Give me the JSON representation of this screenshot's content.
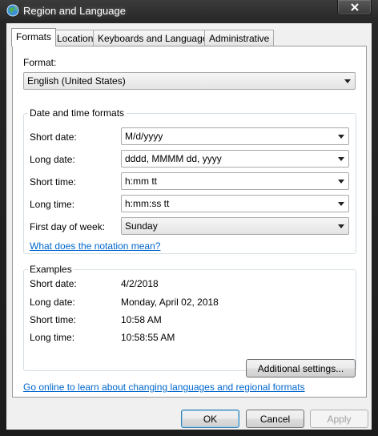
{
  "window": {
    "title": "Region and Language"
  },
  "tabs": [
    {
      "label": "Formats"
    },
    {
      "label": "Location"
    },
    {
      "label": "Keyboards and Languages"
    },
    {
      "label": "Administrative"
    }
  ],
  "format": {
    "label": "Format:",
    "value": "English (United States)"
  },
  "date_time_formats": {
    "title": "Date and time formats",
    "short_date": {
      "label": "Short date:",
      "value": "M/d/yyyy"
    },
    "long_date": {
      "label": "Long date:",
      "value": "dddd, MMMM dd, yyyy"
    },
    "short_time": {
      "label": "Short time:",
      "value": "h:mm tt"
    },
    "long_time": {
      "label": "Long time:",
      "value": "h:mm:ss tt"
    },
    "first_day": {
      "label": "First day of week:",
      "value": "Sunday"
    },
    "notation_link": "What does the notation mean?"
  },
  "examples": {
    "title": "Examples",
    "short_date": {
      "label": "Short date:",
      "value": "4/2/2018"
    },
    "long_date": {
      "label": "Long date:",
      "value": "Monday, April 02, 2018"
    },
    "short_time": {
      "label": "Short time:",
      "value": "10:58 AM"
    },
    "long_time": {
      "label": "Long time:",
      "value": "10:58:55 AM"
    }
  },
  "additional_settings_label": "Additional settings...",
  "online_link": "Go online to learn about changing languages and regional formats",
  "buttons": {
    "ok": "OK",
    "cancel": "Cancel",
    "apply": "Apply"
  }
}
